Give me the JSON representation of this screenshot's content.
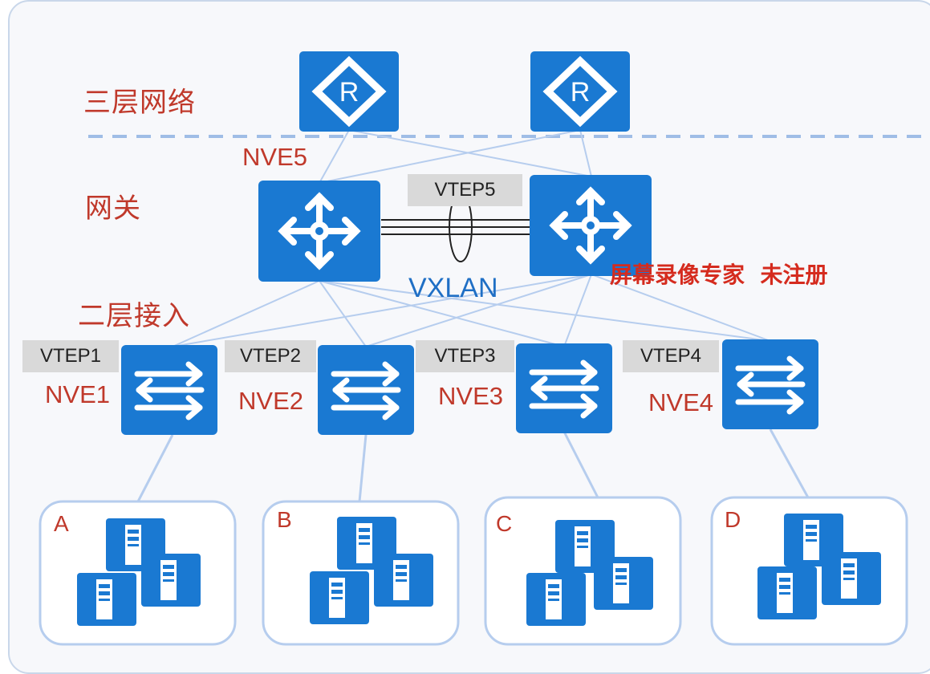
{
  "layers": {
    "l3": "三层网络",
    "gateway": "网关",
    "l2": "二层接入"
  },
  "gateway": {
    "nve_label": "NVE5",
    "vtep_label": "VTEP5",
    "tunnel_label": "VXLAN"
  },
  "access": [
    {
      "vtep": "VTEP1",
      "nve": "NVE1"
    },
    {
      "vtep": "VTEP2",
      "nve": "NVE2"
    },
    {
      "vtep": "VTEP3",
      "nve": "NVE3"
    },
    {
      "vtep": "VTEP4",
      "nve": "NVE4"
    }
  ],
  "groups": [
    "A",
    "B",
    "C",
    "D"
  ],
  "watermark": "屏幕录像专家  未注册",
  "colors": {
    "device_blue": "#1a79d2",
    "label_red": "#c0392b",
    "link_blue": "#a9c4ea",
    "dash_blue": "#9fbde6",
    "vxlan_blue": "#1f6fc5"
  },
  "icons": {
    "router": "router-icon",
    "core_switch": "core-switch-icon",
    "access_switch": "access-switch-icon",
    "server": "server-icon"
  }
}
